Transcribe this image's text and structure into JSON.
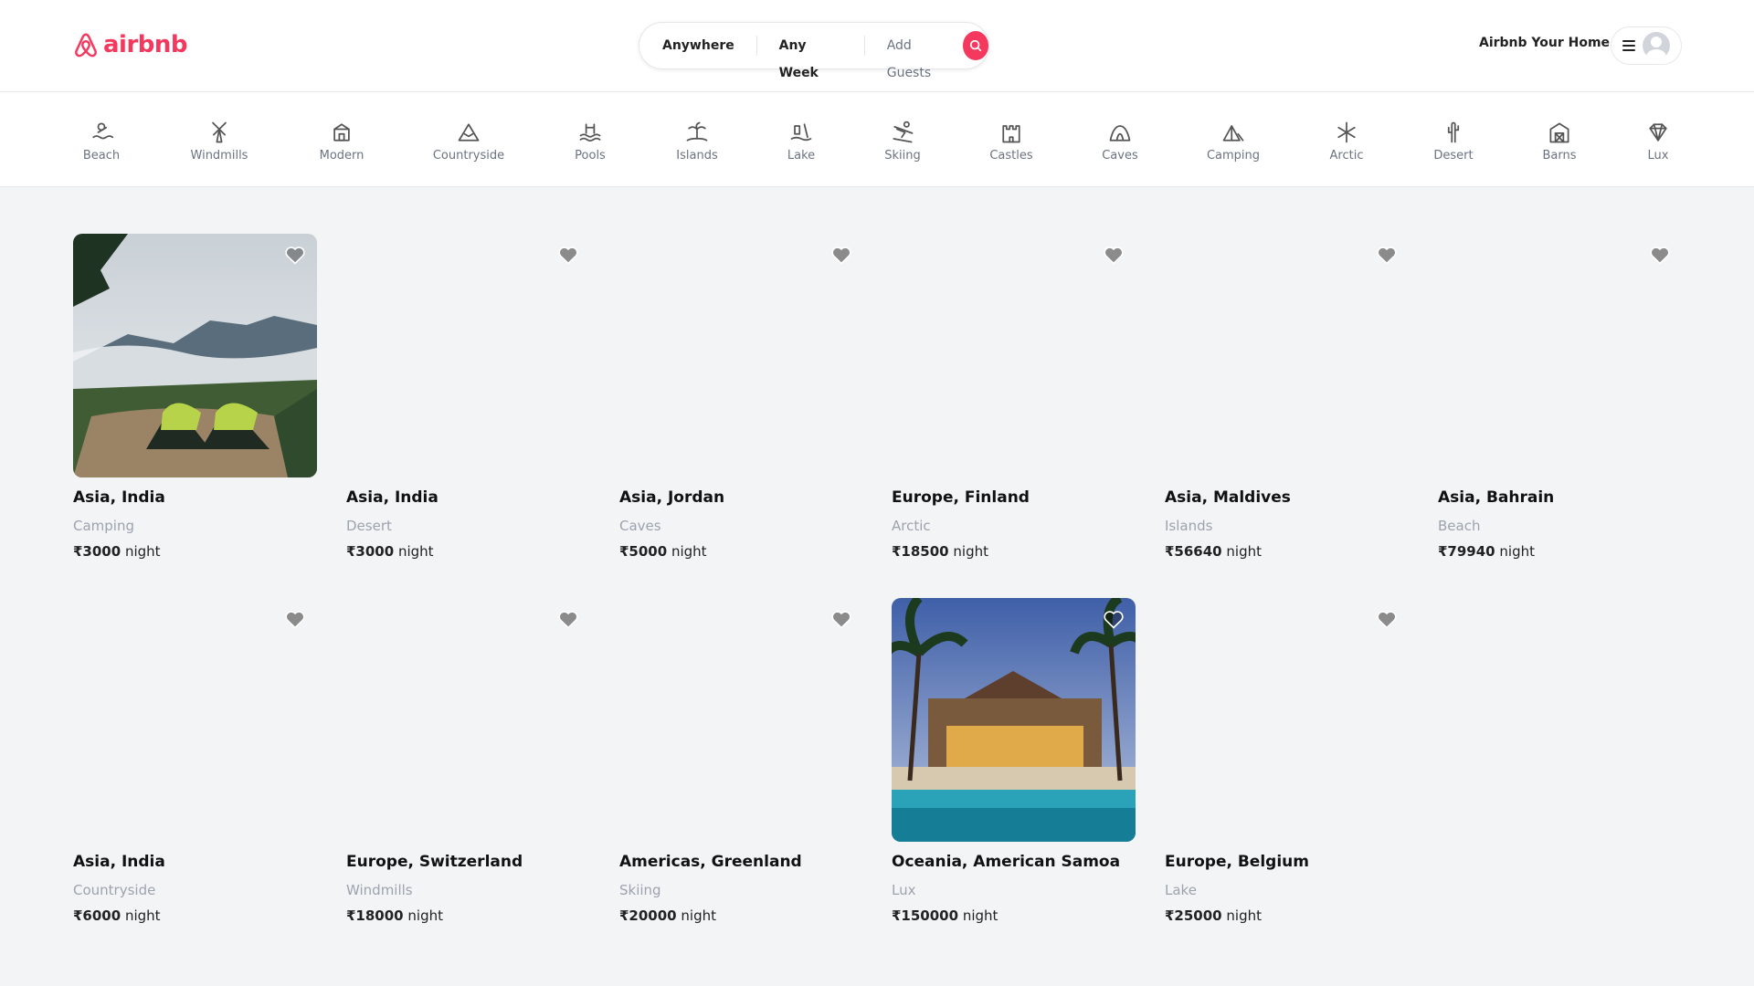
{
  "brand": {
    "name": "airbnb",
    "color": "#f5385d"
  },
  "search": {
    "where": "Anywhere",
    "when": "Any Week",
    "guests": "Add Guests"
  },
  "header": {
    "host_link": "Airbnb Your Home"
  },
  "categories": [
    {
      "label": "Beach",
      "icon": "beach-icon"
    },
    {
      "label": "Windmills",
      "icon": "windmill-icon"
    },
    {
      "label": "Modern",
      "icon": "modern-house-icon"
    },
    {
      "label": "Countryside",
      "icon": "mountain-icon"
    },
    {
      "label": "Pools",
      "icon": "pool-icon"
    },
    {
      "label": "Islands",
      "icon": "island-icon"
    },
    {
      "label": "Lake",
      "icon": "lake-icon"
    },
    {
      "label": "Skiing",
      "icon": "skiing-icon"
    },
    {
      "label": "Castles",
      "icon": "castle-icon"
    },
    {
      "label": "Caves",
      "icon": "cave-icon"
    },
    {
      "label": "Camping",
      "icon": "camping-icon"
    },
    {
      "label": "Arctic",
      "icon": "snowflake-icon"
    },
    {
      "label": "Desert",
      "icon": "cactus-icon"
    },
    {
      "label": "Barns",
      "icon": "barn-icon"
    },
    {
      "label": "Lux",
      "icon": "diamond-icon"
    }
  ],
  "listings": [
    {
      "location": "Asia, India",
      "category": "Camping",
      "price": "₹3000",
      "unit": " night",
      "image": "tents-in-mountains"
    },
    {
      "location": "Asia, India",
      "category": "Desert",
      "price": "₹3000",
      "unit": " night",
      "image": ""
    },
    {
      "location": "Asia, Jordan",
      "category": "Caves",
      "price": "₹5000",
      "unit": " night",
      "image": ""
    },
    {
      "location": "Europe, Finland",
      "category": "Arctic",
      "price": "₹18500",
      "unit": " night",
      "image": ""
    },
    {
      "location": "Asia, Maldives",
      "category": "Islands",
      "price": "₹56640",
      "unit": " night",
      "image": ""
    },
    {
      "location": "Asia, Bahrain",
      "category": "Beach",
      "price": "₹79940",
      "unit": " night",
      "image": ""
    },
    {
      "location": "Asia, India",
      "category": "Countryside",
      "price": "₹6000",
      "unit": " night",
      "image": ""
    },
    {
      "location": "Europe, Switzerland",
      "category": "Windmills",
      "price": "₹18000",
      "unit": " night",
      "image": ""
    },
    {
      "location": "Americas, Greenland",
      "category": "Skiing",
      "price": "₹20000",
      "unit": " night",
      "image": ""
    },
    {
      "location": "Oceania, American Samoa",
      "category": "Lux",
      "price": "₹150000",
      "unit": " night",
      "image": "resort-pool-palms"
    },
    {
      "location": "Europe, Belgium",
      "category": "Lake",
      "price": "₹25000",
      "unit": " night",
      "image": ""
    }
  ]
}
